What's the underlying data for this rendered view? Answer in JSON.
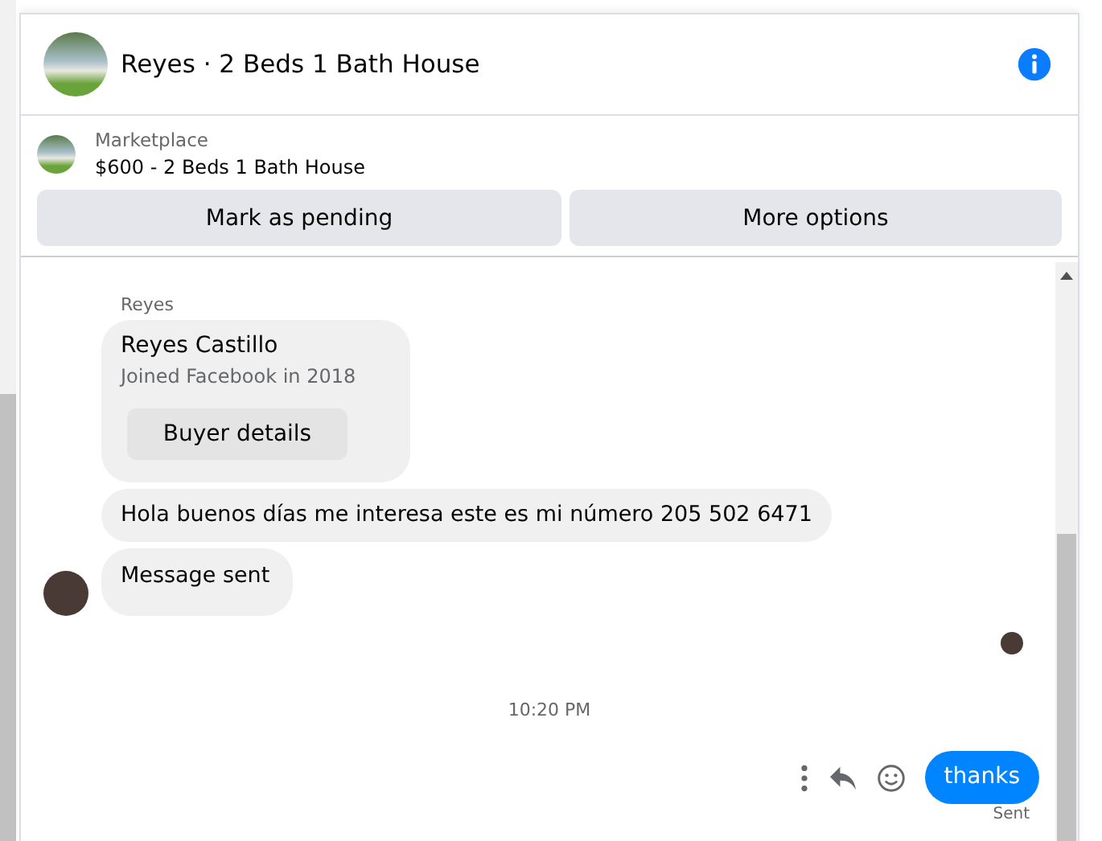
{
  "header": {
    "title": "Reyes · 2 Beds 1 Bath House"
  },
  "listing": {
    "source": "Marketplace",
    "title": "$600 - 2 Beds 1 Bath House"
  },
  "actions": [
    "Mark as pending",
    "More options"
  ],
  "chat": {
    "sender": "Reyes",
    "profile_card": {
      "name": "Reyes Castillo",
      "joined": "Joined Facebook in 2018",
      "button": "Buyer details"
    },
    "messages": [
      {
        "kind": "text",
        "text": "Hola buenos días me interesa este es mi número 205 502 6471"
      },
      {
        "kind": "notice",
        "text": "Message sent"
      }
    ],
    "timestamp": "10:20 PM",
    "outgoing": {
      "text": "thanks",
      "status": "Sent"
    }
  }
}
